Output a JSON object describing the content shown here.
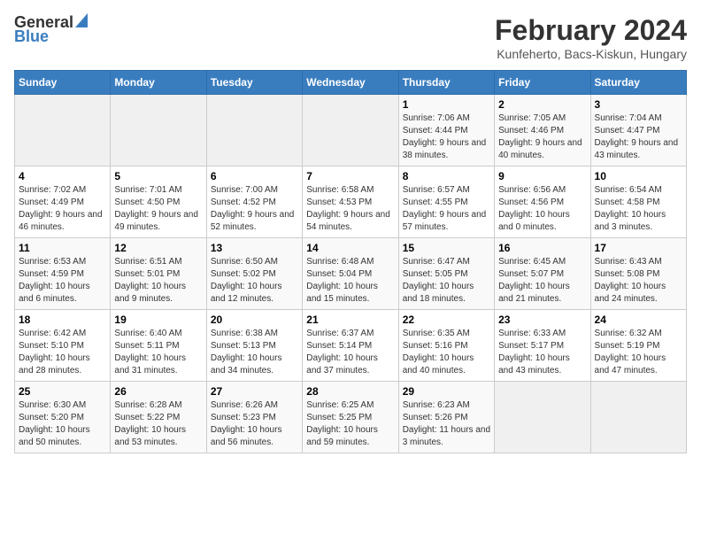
{
  "logo": {
    "general": "General",
    "blue": "Blue"
  },
  "header": {
    "month": "February 2024",
    "location": "Kunfeherto, Bacs-Kiskun, Hungary"
  },
  "weekdays": [
    "Sunday",
    "Monday",
    "Tuesday",
    "Wednesday",
    "Thursday",
    "Friday",
    "Saturday"
  ],
  "weeks": [
    [
      {
        "day": "",
        "sunrise": "",
        "sunset": "",
        "daylight": ""
      },
      {
        "day": "",
        "sunrise": "",
        "sunset": "",
        "daylight": ""
      },
      {
        "day": "",
        "sunrise": "",
        "sunset": "",
        "daylight": ""
      },
      {
        "day": "",
        "sunrise": "",
        "sunset": "",
        "daylight": ""
      },
      {
        "day": "1",
        "sunrise": "Sunrise: 7:06 AM",
        "sunset": "Sunset: 4:44 PM",
        "daylight": "Daylight: 9 hours and 38 minutes."
      },
      {
        "day": "2",
        "sunrise": "Sunrise: 7:05 AM",
        "sunset": "Sunset: 4:46 PM",
        "daylight": "Daylight: 9 hours and 40 minutes."
      },
      {
        "day": "3",
        "sunrise": "Sunrise: 7:04 AM",
        "sunset": "Sunset: 4:47 PM",
        "daylight": "Daylight: 9 hours and 43 minutes."
      }
    ],
    [
      {
        "day": "4",
        "sunrise": "Sunrise: 7:02 AM",
        "sunset": "Sunset: 4:49 PM",
        "daylight": "Daylight: 9 hours and 46 minutes."
      },
      {
        "day": "5",
        "sunrise": "Sunrise: 7:01 AM",
        "sunset": "Sunset: 4:50 PM",
        "daylight": "Daylight: 9 hours and 49 minutes."
      },
      {
        "day": "6",
        "sunrise": "Sunrise: 7:00 AM",
        "sunset": "Sunset: 4:52 PM",
        "daylight": "Daylight: 9 hours and 52 minutes."
      },
      {
        "day": "7",
        "sunrise": "Sunrise: 6:58 AM",
        "sunset": "Sunset: 4:53 PM",
        "daylight": "Daylight: 9 hours and 54 minutes."
      },
      {
        "day": "8",
        "sunrise": "Sunrise: 6:57 AM",
        "sunset": "Sunset: 4:55 PM",
        "daylight": "Daylight: 9 hours and 57 minutes."
      },
      {
        "day": "9",
        "sunrise": "Sunrise: 6:56 AM",
        "sunset": "Sunset: 4:56 PM",
        "daylight": "Daylight: 10 hours and 0 minutes."
      },
      {
        "day": "10",
        "sunrise": "Sunrise: 6:54 AM",
        "sunset": "Sunset: 4:58 PM",
        "daylight": "Daylight: 10 hours and 3 minutes."
      }
    ],
    [
      {
        "day": "11",
        "sunrise": "Sunrise: 6:53 AM",
        "sunset": "Sunset: 4:59 PM",
        "daylight": "Daylight: 10 hours and 6 minutes."
      },
      {
        "day": "12",
        "sunrise": "Sunrise: 6:51 AM",
        "sunset": "Sunset: 5:01 PM",
        "daylight": "Daylight: 10 hours and 9 minutes."
      },
      {
        "day": "13",
        "sunrise": "Sunrise: 6:50 AM",
        "sunset": "Sunset: 5:02 PM",
        "daylight": "Daylight: 10 hours and 12 minutes."
      },
      {
        "day": "14",
        "sunrise": "Sunrise: 6:48 AM",
        "sunset": "Sunset: 5:04 PM",
        "daylight": "Daylight: 10 hours and 15 minutes."
      },
      {
        "day": "15",
        "sunrise": "Sunrise: 6:47 AM",
        "sunset": "Sunset: 5:05 PM",
        "daylight": "Daylight: 10 hours and 18 minutes."
      },
      {
        "day": "16",
        "sunrise": "Sunrise: 6:45 AM",
        "sunset": "Sunset: 5:07 PM",
        "daylight": "Daylight: 10 hours and 21 minutes."
      },
      {
        "day": "17",
        "sunrise": "Sunrise: 6:43 AM",
        "sunset": "Sunset: 5:08 PM",
        "daylight": "Daylight: 10 hours and 24 minutes."
      }
    ],
    [
      {
        "day": "18",
        "sunrise": "Sunrise: 6:42 AM",
        "sunset": "Sunset: 5:10 PM",
        "daylight": "Daylight: 10 hours and 28 minutes."
      },
      {
        "day": "19",
        "sunrise": "Sunrise: 6:40 AM",
        "sunset": "Sunset: 5:11 PM",
        "daylight": "Daylight: 10 hours and 31 minutes."
      },
      {
        "day": "20",
        "sunrise": "Sunrise: 6:38 AM",
        "sunset": "Sunset: 5:13 PM",
        "daylight": "Daylight: 10 hours and 34 minutes."
      },
      {
        "day": "21",
        "sunrise": "Sunrise: 6:37 AM",
        "sunset": "Sunset: 5:14 PM",
        "daylight": "Daylight: 10 hours and 37 minutes."
      },
      {
        "day": "22",
        "sunrise": "Sunrise: 6:35 AM",
        "sunset": "Sunset: 5:16 PM",
        "daylight": "Daylight: 10 hours and 40 minutes."
      },
      {
        "day": "23",
        "sunrise": "Sunrise: 6:33 AM",
        "sunset": "Sunset: 5:17 PM",
        "daylight": "Daylight: 10 hours and 43 minutes."
      },
      {
        "day": "24",
        "sunrise": "Sunrise: 6:32 AM",
        "sunset": "Sunset: 5:19 PM",
        "daylight": "Daylight: 10 hours and 47 minutes."
      }
    ],
    [
      {
        "day": "25",
        "sunrise": "Sunrise: 6:30 AM",
        "sunset": "Sunset: 5:20 PM",
        "daylight": "Daylight: 10 hours and 50 minutes."
      },
      {
        "day": "26",
        "sunrise": "Sunrise: 6:28 AM",
        "sunset": "Sunset: 5:22 PM",
        "daylight": "Daylight: 10 hours and 53 minutes."
      },
      {
        "day": "27",
        "sunrise": "Sunrise: 6:26 AM",
        "sunset": "Sunset: 5:23 PM",
        "daylight": "Daylight: 10 hours and 56 minutes."
      },
      {
        "day": "28",
        "sunrise": "Sunrise: 6:25 AM",
        "sunset": "Sunset: 5:25 PM",
        "daylight": "Daylight: 10 hours and 59 minutes."
      },
      {
        "day": "29",
        "sunrise": "Sunrise: 6:23 AM",
        "sunset": "Sunset: 5:26 PM",
        "daylight": "Daylight: 11 hours and 3 minutes."
      },
      {
        "day": "",
        "sunrise": "",
        "sunset": "",
        "daylight": ""
      },
      {
        "day": "",
        "sunrise": "",
        "sunset": "",
        "daylight": ""
      }
    ]
  ]
}
